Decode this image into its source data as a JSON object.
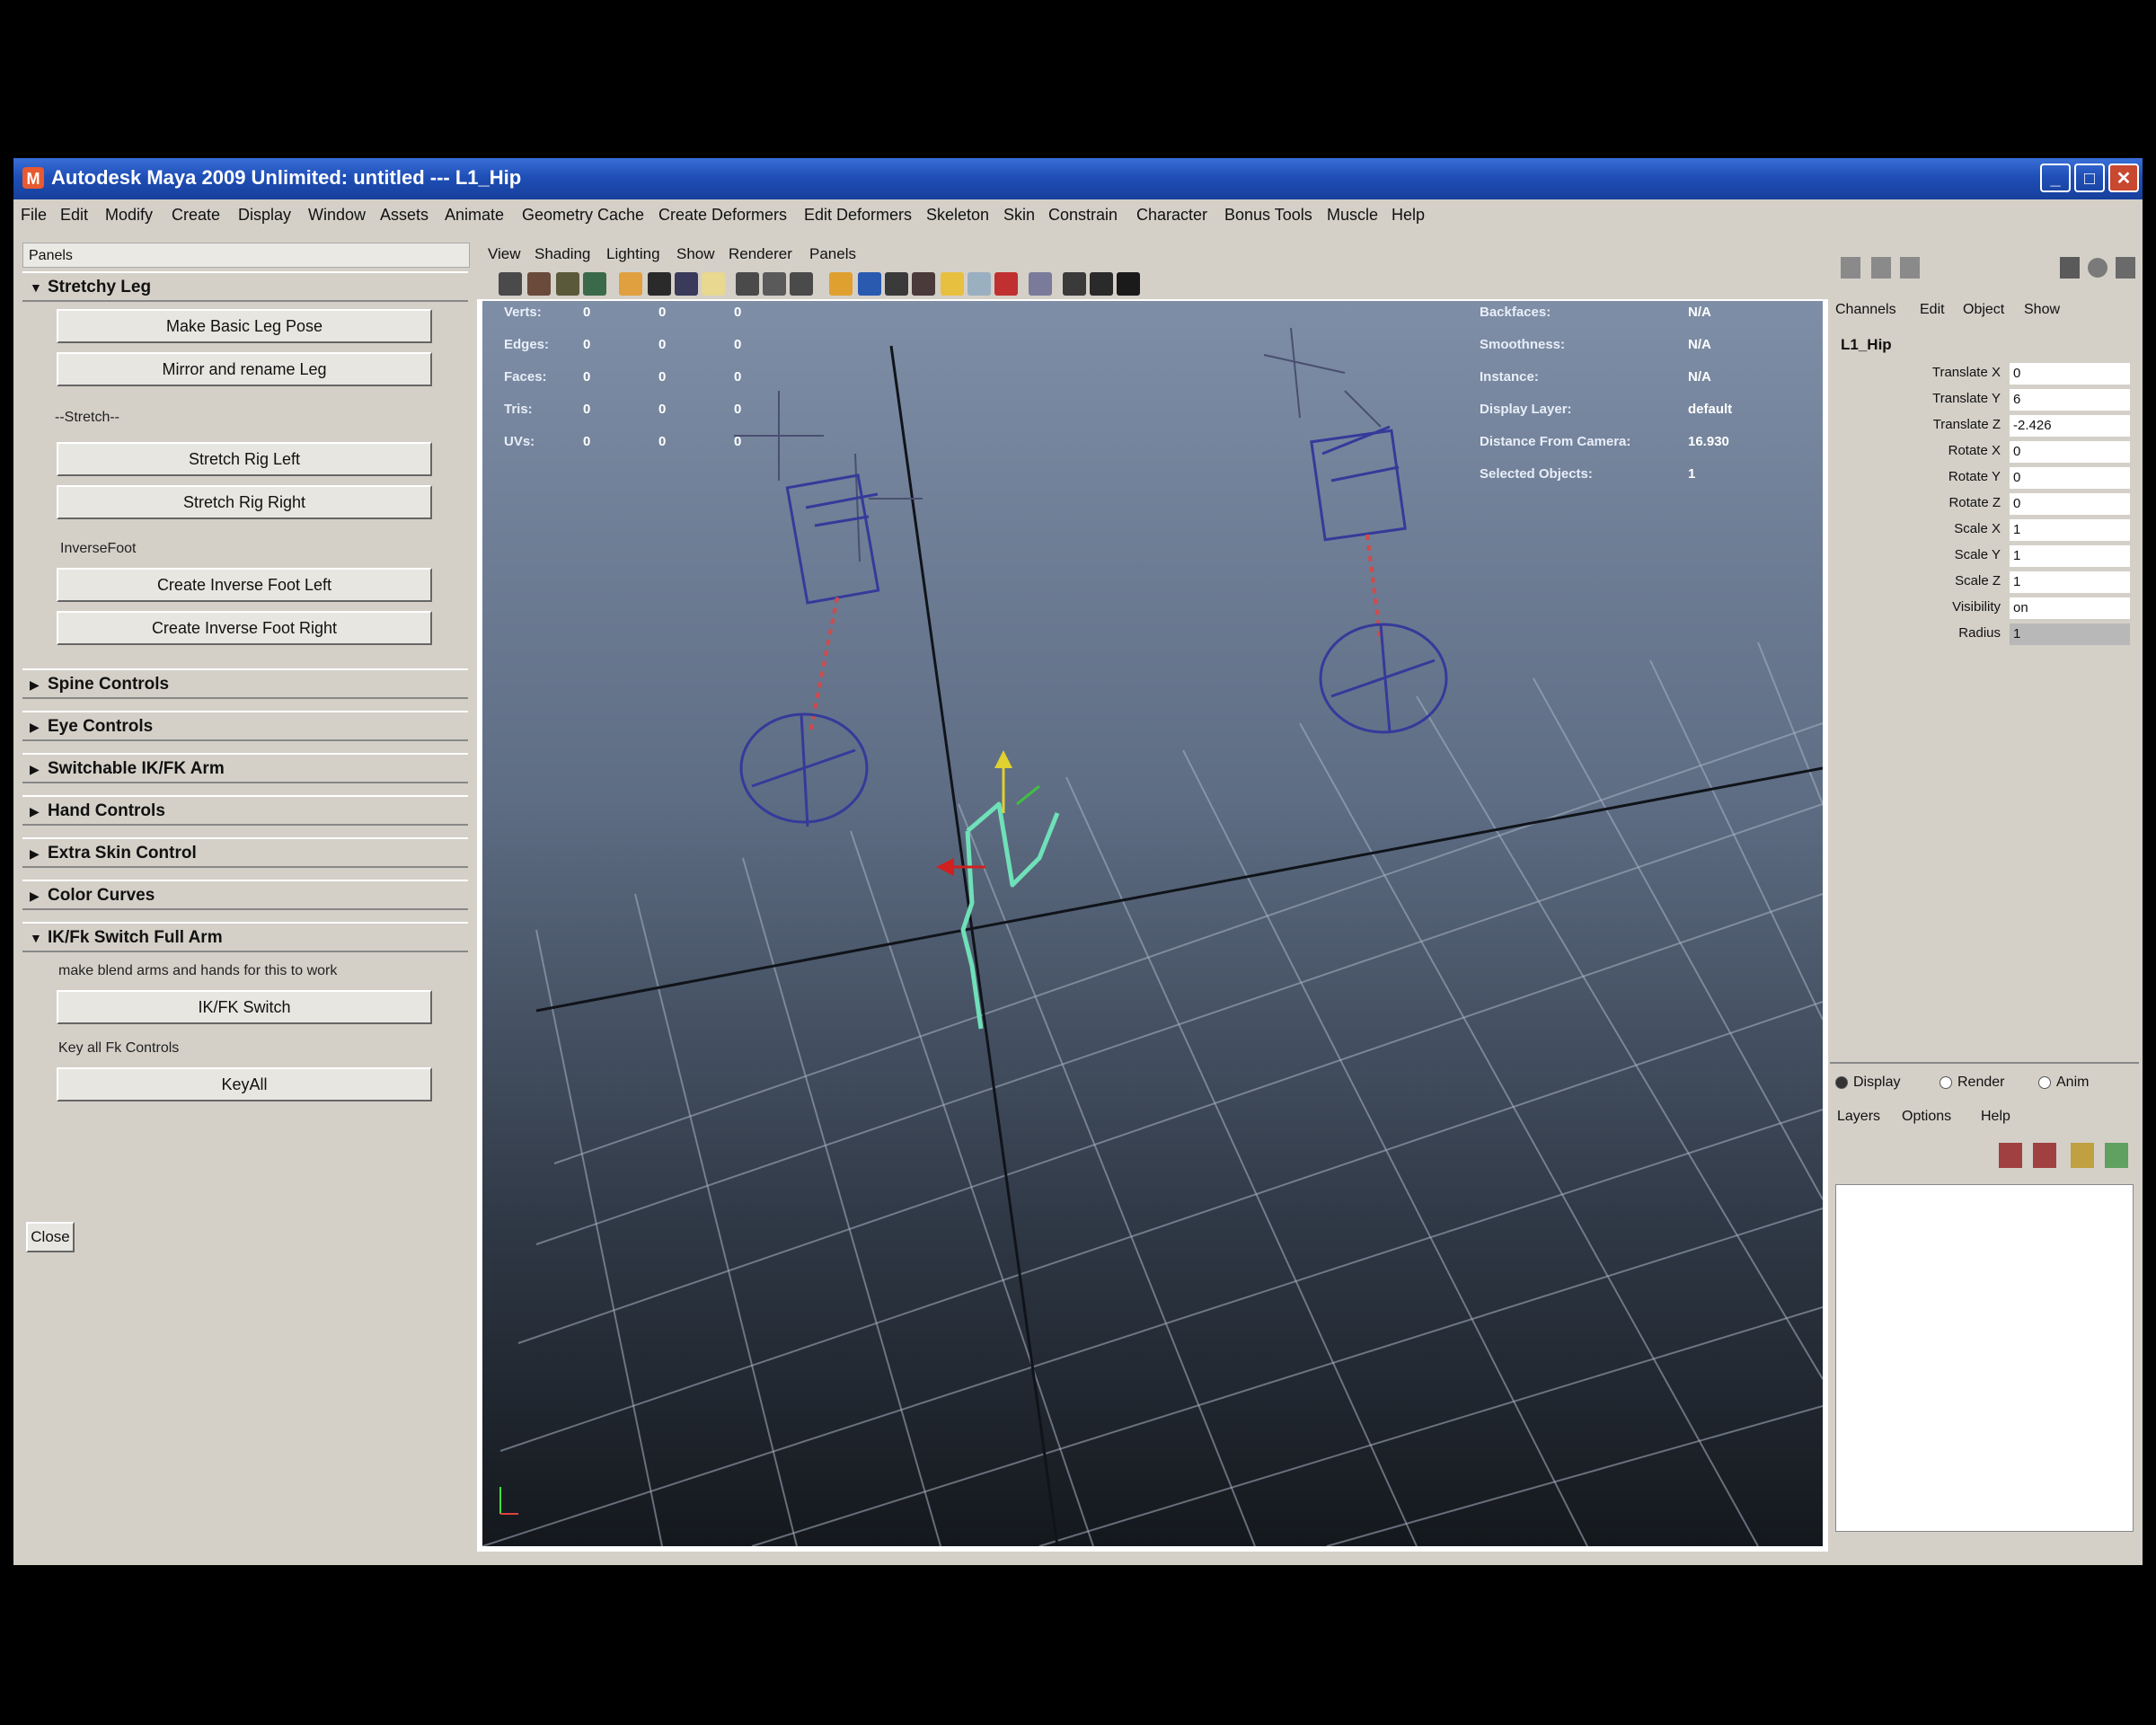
{
  "window": {
    "title": "Autodesk Maya 2009 Unlimited: untitled   ---   L1_Hip",
    "controls": [
      "_",
      "□",
      "✕"
    ]
  },
  "menubar": [
    "File",
    "Edit",
    "Modify",
    "Create",
    "Display",
    "Window",
    "Assets",
    "Animate",
    "Geometry Cache",
    "Create Deformers",
    "Edit Deformers",
    "Skeleton",
    "Skin",
    "Constrain",
    "Character",
    "Bonus Tools",
    "Muscle",
    "Help"
  ],
  "left_panel": {
    "title": "Panels",
    "stretchy_leg": {
      "header": "Stretchy Leg",
      "btn_basic_pose": "Make Basic Leg Pose",
      "btn_mirror": "Mirror and rename Leg",
      "stretch_label": "--Stretch--",
      "btn_stretch_left": "Stretch Rig Left",
      "btn_stretch_right": "Stretch Rig Right",
      "inversefoot_label": "InverseFoot",
      "btn_inv_left": "Create Inverse Foot Left",
      "btn_inv_right": "Create Inverse Foot Right"
    },
    "sections": [
      "Spine Controls",
      "Eye Controls",
      "Switchable IK/FK Arm",
      "Hand Controls",
      "Extra Skin Control",
      "Color Curves"
    ],
    "ikfk": {
      "header": "IK/Fk Switch Full Arm",
      "note": "make blend arms and hands for this to work",
      "btn_switch": "IK/FK Switch",
      "key_label": "Key all Fk Controls",
      "btn_keyall": "KeyAll"
    },
    "close": "Close"
  },
  "viewport": {
    "menu": [
      "View",
      "Shading",
      "Lighting",
      "Show",
      "Renderer",
      "Panels"
    ],
    "hud_left": [
      {
        "label": "Verts:",
        "a": "0",
        "b": "0",
        "c": "0"
      },
      {
        "label": "Edges:",
        "a": "0",
        "b": "0",
        "c": "0"
      },
      {
        "label": "Faces:",
        "a": "0",
        "b": "0",
        "c": "0"
      },
      {
        "label": "Tris:",
        "a": "0",
        "b": "0",
        "c": "0"
      },
      {
        "label": "UVs:",
        "a": "0",
        "b": "0",
        "c": "0"
      }
    ],
    "hud_right": [
      {
        "label": "Backfaces:",
        "value": "N/A"
      },
      {
        "label": "Smoothness:",
        "value": "N/A"
      },
      {
        "label": "Instance:",
        "value": "N/A"
      },
      {
        "label": "Display Layer:",
        "value": "default"
      },
      {
        "label": "Distance From Camera:",
        "value": "16.930"
      },
      {
        "label": "Selected Objects:",
        "value": "1"
      }
    ],
    "colors": {
      "bg_top": "#7e8ea6",
      "bg_bottom": "#14181d",
      "grid": "#9aa4b4",
      "skeleton": "#6fe0b8",
      "ctrl": "#3a3f9a",
      "ik": "#d04a4a"
    }
  },
  "channel_box": {
    "tabs": [
      "Channels",
      "Edit",
      "Object",
      "Show"
    ],
    "node": "L1_Hip",
    "channels": [
      {
        "name": "Translate X",
        "value": "0"
      },
      {
        "name": "Translate Y",
        "value": "6"
      },
      {
        "name": "Translate Z",
        "value": "-2.426"
      },
      {
        "name": "Rotate X",
        "value": "0"
      },
      {
        "name": "Rotate Y",
        "value": "0"
      },
      {
        "name": "Rotate Z",
        "value": "0"
      },
      {
        "name": "Scale X",
        "value": "1"
      },
      {
        "name": "Scale Y",
        "value": "1"
      },
      {
        "name": "Scale Z",
        "value": "1"
      },
      {
        "name": "Visibility",
        "value": "on"
      },
      {
        "name": "Radius",
        "value": "1"
      }
    ]
  },
  "layer_editor": {
    "modes": [
      "Display",
      "Render",
      "Anim"
    ],
    "menu": [
      "Layers",
      "Options",
      "Help"
    ]
  }
}
